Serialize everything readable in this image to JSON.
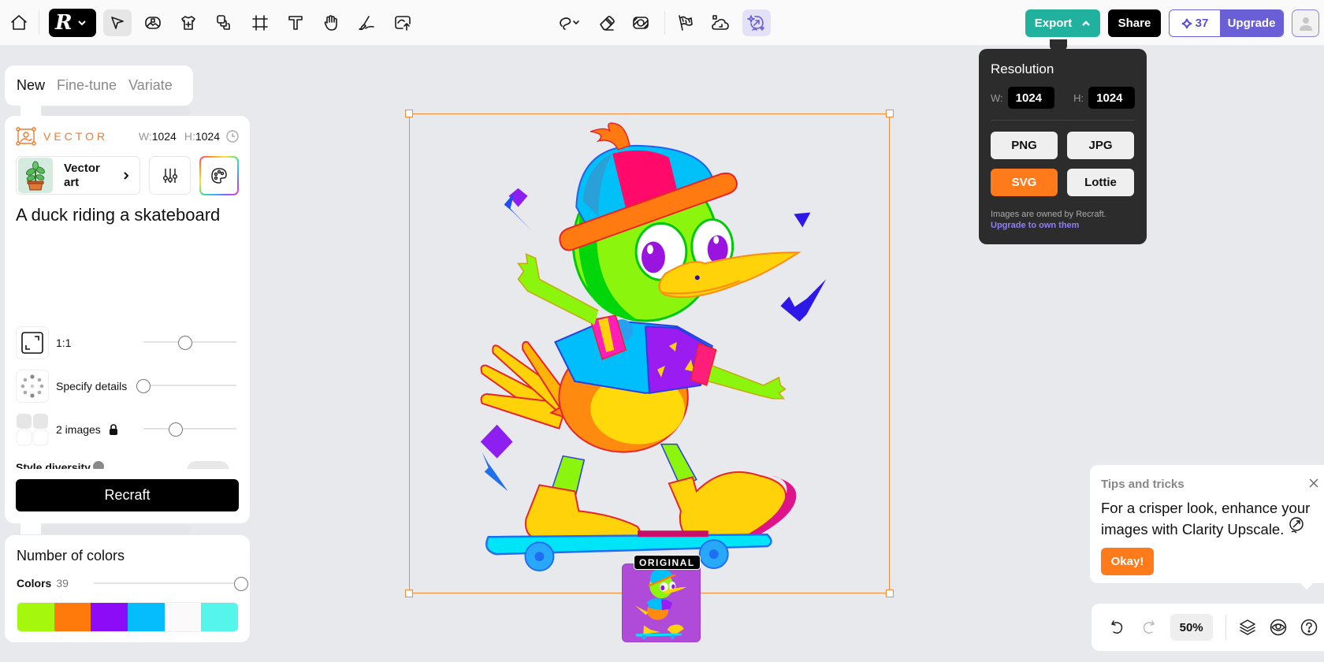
{
  "toolbar": {
    "left_tools": [
      {
        "name": "home",
        "icon": "home-icon"
      },
      {
        "name": "select",
        "icon": "cursor-icon",
        "active": true
      },
      {
        "name": "image",
        "icon": "image-frame-icon"
      },
      {
        "name": "mockup",
        "icon": "tshirt-icon"
      },
      {
        "name": "layers",
        "icon": "stack-icon"
      },
      {
        "name": "frame",
        "icon": "crop-frame-icon"
      },
      {
        "name": "text",
        "icon": "text-icon"
      },
      {
        "name": "hand",
        "icon": "hand-icon"
      },
      {
        "name": "brush",
        "icon": "brush-icon"
      },
      {
        "name": "upload",
        "icon": "upload-icon"
      }
    ],
    "center_tools": [
      {
        "name": "lasso",
        "icon": "lasso-icon"
      },
      {
        "name": "eraser",
        "icon": "eraser-icon"
      },
      {
        "name": "remove-background",
        "icon": "remove-bg-icon"
      },
      {
        "name": "vectorize",
        "icon": "flag-icon"
      },
      {
        "name": "generate-background",
        "icon": "cloud-icon"
      },
      {
        "name": "upscale",
        "icon": "upscale-sparkle-icon",
        "active": true
      }
    ],
    "logo_letter": "R",
    "export_label": "Export",
    "share_label": "Share",
    "credits": "37",
    "upgrade_label": "Upgrade"
  },
  "export_menu": {
    "title": "Resolution",
    "width_label": "W:",
    "width_value": "1024",
    "height_label": "H:",
    "height_value": "1024",
    "formats": [
      {
        "label": "PNG",
        "selected": false
      },
      {
        "label": "JPG",
        "selected": false
      },
      {
        "label": "SVG",
        "selected": true
      },
      {
        "label": "Lottie",
        "selected": false
      }
    ],
    "note": "Images are owned by Recraft.",
    "link": "Upgrade to own them"
  },
  "mode_tabs": [
    {
      "label": "New",
      "active": true
    },
    {
      "label": "Fine-tune",
      "active": false
    },
    {
      "label": "Variate",
      "active": false
    }
  ],
  "generator": {
    "type_label": "VECTOR",
    "w_label": "W:",
    "w_value": "1024",
    "h_label": "H:",
    "h_value": "1024",
    "style_name": "Vector art",
    "prompt": "A duck riding a skateboard",
    "options": [
      {
        "label": "1:1",
        "slider": 0.45
      },
      {
        "label": "Specify details",
        "slider": 0.0
      },
      {
        "label": "2 images",
        "slider": 0.35,
        "locked": true
      }
    ],
    "style_diversity_label": "Style diversity",
    "recraft_label": "Recraft"
  },
  "colors": {
    "title": "Number of colors",
    "label": "Colors",
    "count": "39",
    "slider": 1.0,
    "swatches": [
      "#a6f70e",
      "#ff7a0a",
      "#8d0cf7",
      "#05bdfc",
      "#fafafa",
      "#55f5ec"
    ]
  },
  "canvas": {
    "original_label": "ORIGINAL",
    "accent": "#f28a3a"
  },
  "tips": {
    "heading": "Tips and tricks",
    "body": "For a crisper look, enhance your images with Clarity Upscale.",
    "ok_label": "Okay!"
  },
  "bottom_bar": {
    "zoom": "50%"
  }
}
